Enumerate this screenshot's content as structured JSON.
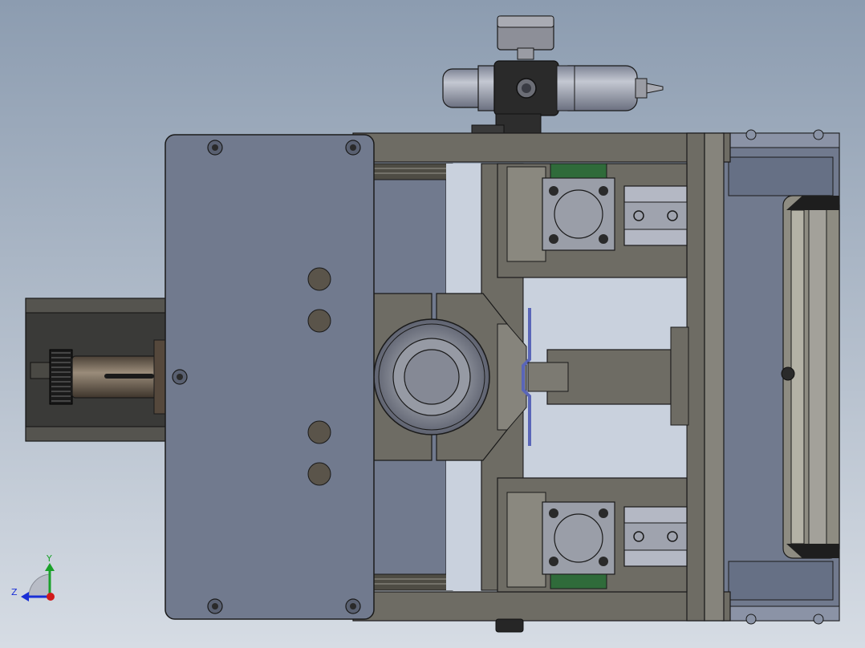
{
  "viewport": {
    "background_top": "#8c9cb0",
    "background_bottom": "#d6dce4"
  },
  "colors": {
    "cover_plate": "#717a8e",
    "frame_dark": "#5c5a52",
    "frame_mid": "#6e6c64",
    "frame_light": "#86847c",
    "steel": "#8d93a3",
    "steel_light": "#b4b8c4",
    "outline": "#1a1a1a",
    "bolt": "#2a2a2a",
    "bolt_hole": "#5a544a",
    "knurl": "#222222",
    "accent_blue": "#5a66b8",
    "accent_green": "#2f6b3a",
    "dark_slot": "#1e1e1e"
  },
  "coordinate_triad": {
    "y_label": "Y",
    "z_label": "Z",
    "y_color": "#1aa12a",
    "z_color": "#1a2fd6",
    "origin_color": "#d21a1a"
  },
  "components": [
    "cover-plate",
    "frame-top-bar",
    "frame-bottom-bar",
    "frame-right-post",
    "right-end-block",
    "left-shaft-housing",
    "knurled-knob",
    "threaded-shaft",
    "v-block-clamp",
    "round-workpiece",
    "center-divider",
    "punch-die",
    "clamp-arm",
    "upper-pneumatic-cylinder",
    "lower-pneumatic-cylinder",
    "upper-guide-slide",
    "lower-guide-slide",
    "air-regulator",
    "pressure-gauge",
    "bottom-foot"
  ]
}
